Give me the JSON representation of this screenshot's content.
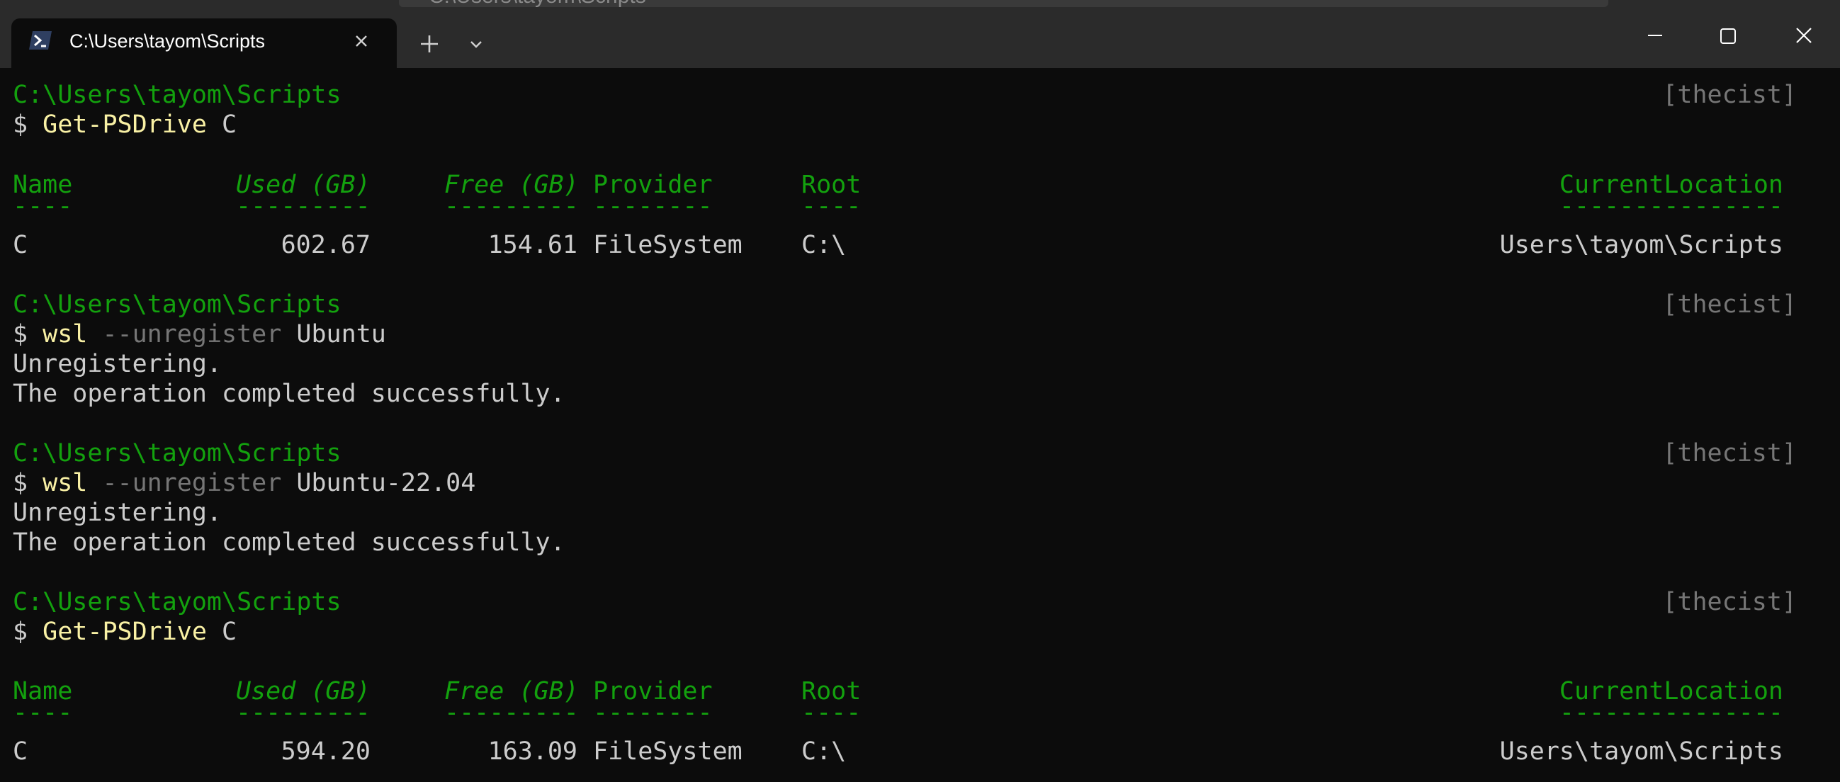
{
  "window": {
    "ghost_title": "C:\\Users\\tayom\\Scripts",
    "tab": {
      "title": "C:\\Users\\tayom\\Scripts",
      "icon": "powershell-icon"
    },
    "buttons": {
      "close_tab": "close-icon",
      "new_tab": "plus-icon",
      "tab_menu": "chevron-down-icon",
      "minimize": "minimize-icon",
      "maximize": "maximize-icon",
      "close": "close-icon"
    }
  },
  "colors": {
    "background": "#0c0c0c",
    "titlebar": "#2b2b2b",
    "prompt_green": "#13a10e",
    "command_yellow": "#f9f1a5",
    "text": "#cccccc",
    "dim": "#767676"
  },
  "terminal": {
    "blocks": [
      {
        "prompt_path": "C:\\Users\\tayom\\Scripts",
        "right_tag": "[thecist]",
        "command": {
          "dollar": "$",
          "cmd": "Get-PSDrive",
          "param": "",
          "arg": "C"
        },
        "table": {
          "headers": [
            "Name",
            "Used (GB)",
            "Free (GB)",
            "Provider",
            "Root",
            "CurrentLocation"
          ],
          "underlines": [
            "----",
            "---------",
            "---------",
            "--------",
            "----",
            "---------------"
          ],
          "row": [
            "C",
            "602.67",
            "154.61",
            "FileSystem",
            "C:\\",
            "Users\\tayom\\Scripts"
          ]
        }
      },
      {
        "prompt_path": "C:\\Users\\tayom\\Scripts",
        "right_tag": "[thecist]",
        "command": {
          "dollar": "$",
          "cmd": "wsl",
          "param": "--unregister",
          "arg": "Ubuntu"
        },
        "output": [
          "Unregistering.",
          "The operation completed successfully."
        ]
      },
      {
        "prompt_path": "C:\\Users\\tayom\\Scripts",
        "right_tag": "[thecist]",
        "command": {
          "dollar": "$",
          "cmd": "wsl",
          "param": "--unregister",
          "arg": "Ubuntu-22.04"
        },
        "output": [
          "Unregistering.",
          "The operation completed successfully."
        ]
      },
      {
        "prompt_path": "C:\\Users\\tayom\\Scripts",
        "right_tag": "[thecist]",
        "command": {
          "dollar": "$",
          "cmd": "Get-PSDrive",
          "param": "",
          "arg": "C"
        },
        "table": {
          "headers": [
            "Name",
            "Used (GB)",
            "Free (GB)",
            "Provider",
            "Root",
            "CurrentLocation"
          ],
          "underlines": [
            "----",
            "---------",
            "---------",
            "--------",
            "----",
            "---------------"
          ],
          "row": [
            "C",
            "594.20",
            "163.09",
            "FileSystem",
            "C:\\",
            "Users\\tayom\\Scripts"
          ]
        }
      }
    ]
  }
}
